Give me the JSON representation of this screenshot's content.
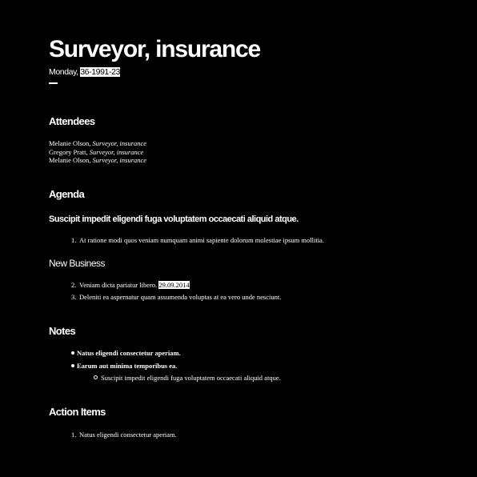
{
  "title": "Surveyor, insurance",
  "date": {
    "weekday": "Monday,",
    "value": "36-1991-23"
  },
  "attendees": {
    "heading": "Attendees",
    "people": [
      {
        "name": "Melanie Olson,",
        "role": "Surveyor, insurance"
      },
      {
        "name": "Gregory Pratt,",
        "role": "Surveyor, insurance"
      },
      {
        "name": "Melanie Olson,",
        "role": "Surveyor, insurance"
      }
    ]
  },
  "agenda": {
    "heading": "Agenda",
    "subheading": "Suscipit impedit eligendi fuga voluptatem occaecati aliquid atque.",
    "items": [
      {
        "num": "1.",
        "text": "At ratione modi quos veniam numquam animi sapiente dolorum molestiae ipsum mollitia."
      }
    ],
    "new_business": {
      "heading": "New Business",
      "items": [
        {
          "num": "2.",
          "text": "Veniam dicta pariatur libero.",
          "date": "29.09.2014"
        },
        {
          "num": "3.",
          "text": "Deleniti ea aspernatur quam assumenda voluptas at ea vero unde nesciunt."
        }
      ]
    }
  },
  "notes": {
    "heading": "Notes",
    "items": [
      {
        "text": "Natus eligendi consectetur aperiam."
      },
      {
        "text": "Earum aut minima temporibus ea."
      }
    ],
    "subitems": [
      {
        "text": "Suscipit impedit eligendi fuga voluptatem occaecati aliquid atque."
      }
    ]
  },
  "action_items": {
    "heading": "Action Items",
    "items": [
      {
        "num": "1.",
        "text": "Natus eligendi consectetur aperiam."
      }
    ]
  }
}
